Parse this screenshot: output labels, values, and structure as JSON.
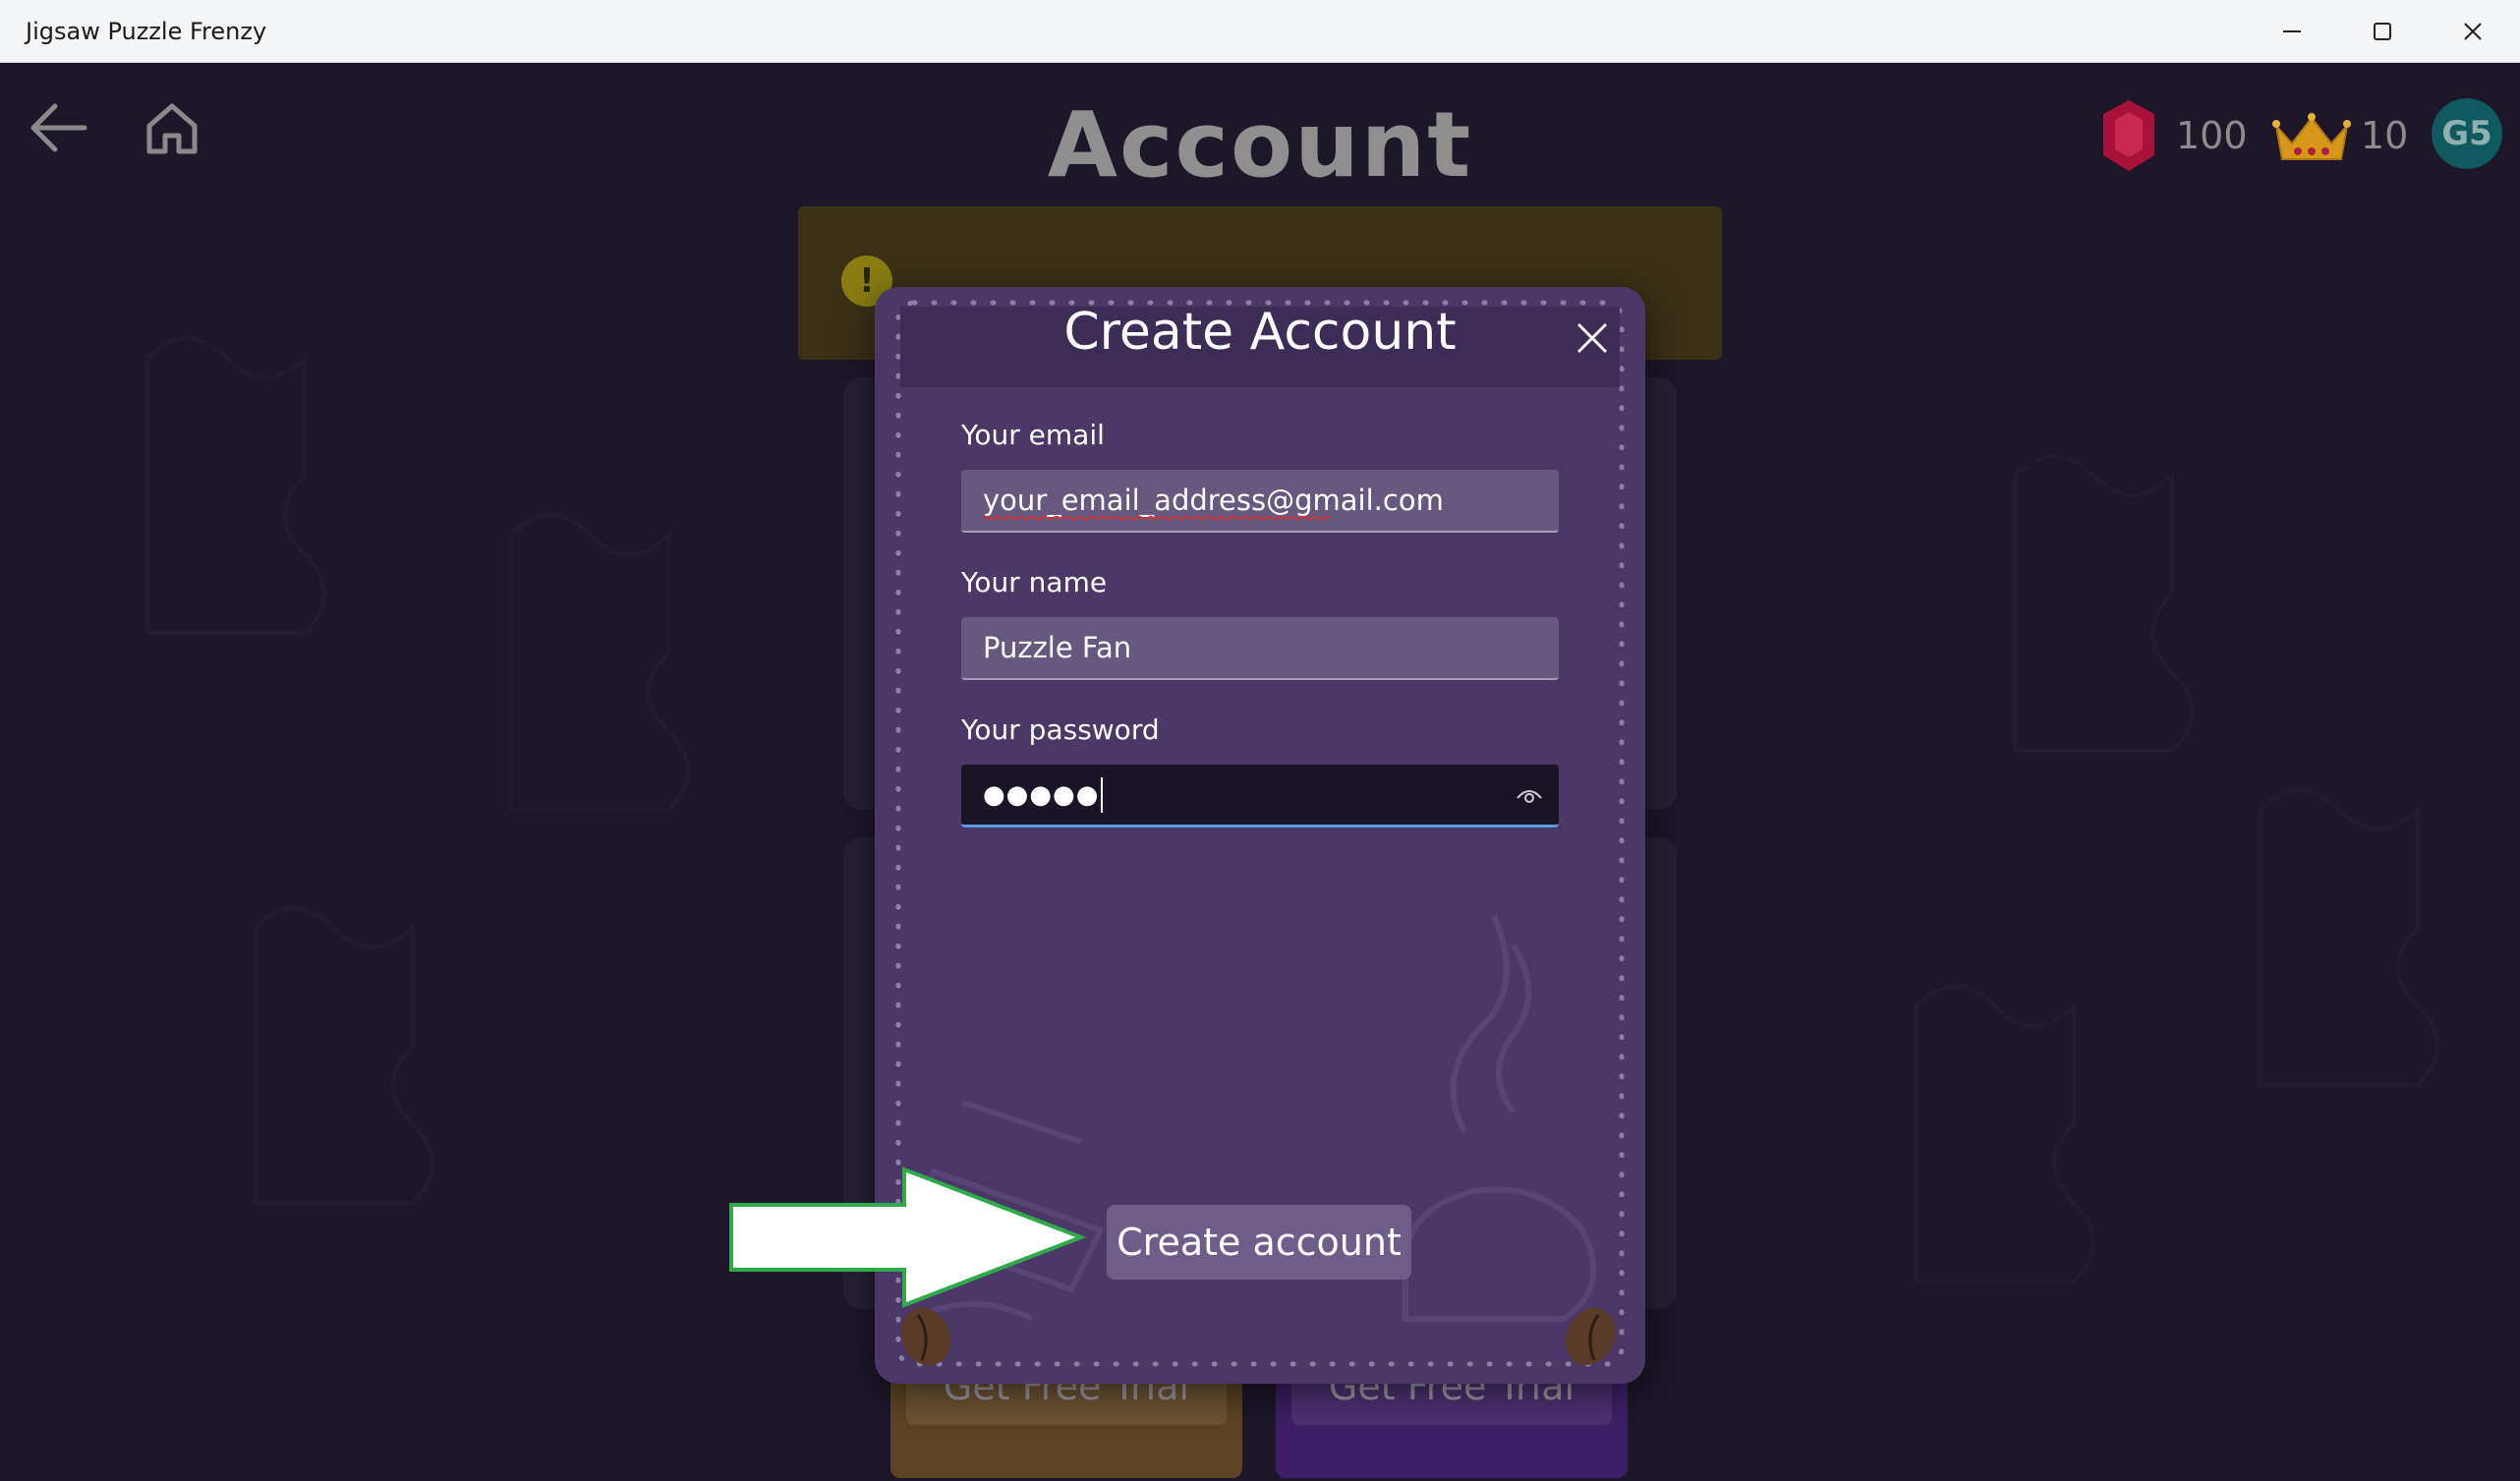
{
  "window": {
    "title": "Jigsaw Puzzle Frenzy"
  },
  "header": {
    "title": "Account",
    "gems": "100",
    "crowns": "10",
    "avatar_initials": "G5"
  },
  "background": {
    "trial_button_1": "Get Free Trial",
    "trial_button_2": "Get Free Trial"
  },
  "modal": {
    "title": "Create Account",
    "email_label": "Your email",
    "email_value": "your_email_address@gmail.com",
    "name_label": "Your name",
    "name_value": "Puzzle Fan",
    "password_label": "Your password",
    "password_mask": "●●●●●",
    "submit_label": "Create account"
  },
  "colors": {
    "app_background": "#1d1729",
    "modal_background": "#4b3867",
    "field_background": "#66587e",
    "focused_field_border": "#5b9be6",
    "arrow_outline": "#2faa4a",
    "gem": "#c0153f",
    "crown": "#e3a21a",
    "avatar": "#0e5a60"
  },
  "icons": {
    "back": "arrow-left-icon",
    "home": "home-icon",
    "gem": "gem-icon",
    "crown": "crown-icon",
    "close": "close-icon",
    "reveal_password": "eye-icon",
    "minimize": "minimize-icon",
    "maximize": "maximize-icon",
    "window_close": "window-close-icon"
  }
}
